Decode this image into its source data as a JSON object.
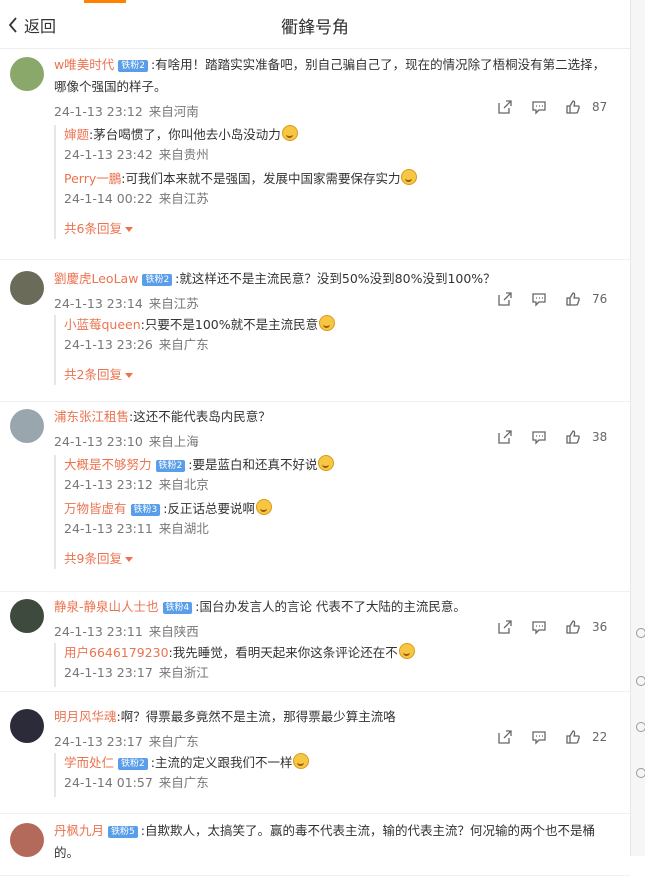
{
  "header": {
    "back_label": "返回",
    "title": "衢鋒号角"
  },
  "comments": [
    {
      "user": "w唯美时代",
      "badge": "铁粉2",
      "text": ":有啥用！踏踏实实准备吧，别自己骗自己了，现在的情况除了梧桐没有第二选择，哪像个强国的样子。",
      "time": "24-1-13 23:12",
      "loc": "来自河南",
      "likes": "87",
      "replies": [
        {
          "user": "婶题",
          "badge": "",
          "text": ":茅台喝惯了，你叫他去小岛没动力",
          "time": "24-1-13 23:42",
          "loc": "来自贵州"
        },
        {
          "user": "Perry一鵬",
          "badge": "",
          "text": ":可我们本来就不是强国，发展中国家需要保存实力",
          "time": "24-1-14 00:22",
          "loc": "来自江苏"
        }
      ],
      "more": "共6条回复"
    },
    {
      "user": "劉慶虎LeoLaw",
      "badge": "铁粉2",
      "text": ":就这样还不是主流民意？没到50%没到80%没到100%？",
      "time": "24-1-13 23:14",
      "loc": "来自江苏",
      "likes": "76",
      "replies": [
        {
          "user": "小蓝莓queen",
          "badge": "",
          "text": ":只要不是100%就不是主流民意",
          "time": "24-1-13 23:26",
          "loc": "来自广东"
        }
      ],
      "more": "共2条回复"
    },
    {
      "user": "浦东张江租售",
      "badge": "",
      "text": ":这还不能代表岛内民意？",
      "time": "24-1-13 23:10",
      "loc": "来自上海",
      "likes": "38",
      "replies": [
        {
          "user": "大概是不够努力",
          "badge": "铁粉2",
          "text": ":要是蓝白和还真不好说",
          "time": "24-1-13 23:12",
          "loc": "来自北京"
        },
        {
          "user": "万物皆虚有",
          "badge": "铁粉3",
          "text": ":反正话总要说啊",
          "time": "24-1-13 23:11",
          "loc": "来自湖北"
        }
      ],
      "more": "共9条回复"
    },
    {
      "user": "静泉-静泉山人士也",
      "badge": "铁粉4",
      "text": ":国台办发言人的言论 代表不了大陆的主流民意。",
      "time": "24-1-13 23:11",
      "loc": "来自陕西",
      "likes": "36",
      "replies": [
        {
          "user": "用户6646179230",
          "badge": "",
          "text": ":我先睡觉，看明天起来你这条评论还在不",
          "time": "24-1-13 23:17",
          "loc": "来自浙江"
        }
      ],
      "more": ""
    },
    {
      "user": "明月风华魂",
      "badge": "",
      "text": ":啊？得票最多竟然不是主流，那得票最少算主流咯",
      "time": "24-1-13 23:17",
      "loc": "来自广东",
      "likes": "22",
      "replies": [
        {
          "user": "学而处仁",
          "badge": "铁粉2",
          "text": ":主流的定义跟我们不一样",
          "time": "24-1-14 01:57",
          "loc": "来自广东"
        }
      ],
      "more": ""
    },
    {
      "user": "丹枫九月",
      "badge": "铁粉5",
      "text": ":自欺欺人，太搞笑了。赢的毒不代表主流，输的代表主流？何况输的两个也不是桶的。",
      "time": "",
      "loc": "",
      "likes": "",
      "replies": [],
      "more": ""
    }
  ],
  "colors": {
    "accent": "#ff8200",
    "name": "#eb7350",
    "badge": "#5a9eea"
  }
}
